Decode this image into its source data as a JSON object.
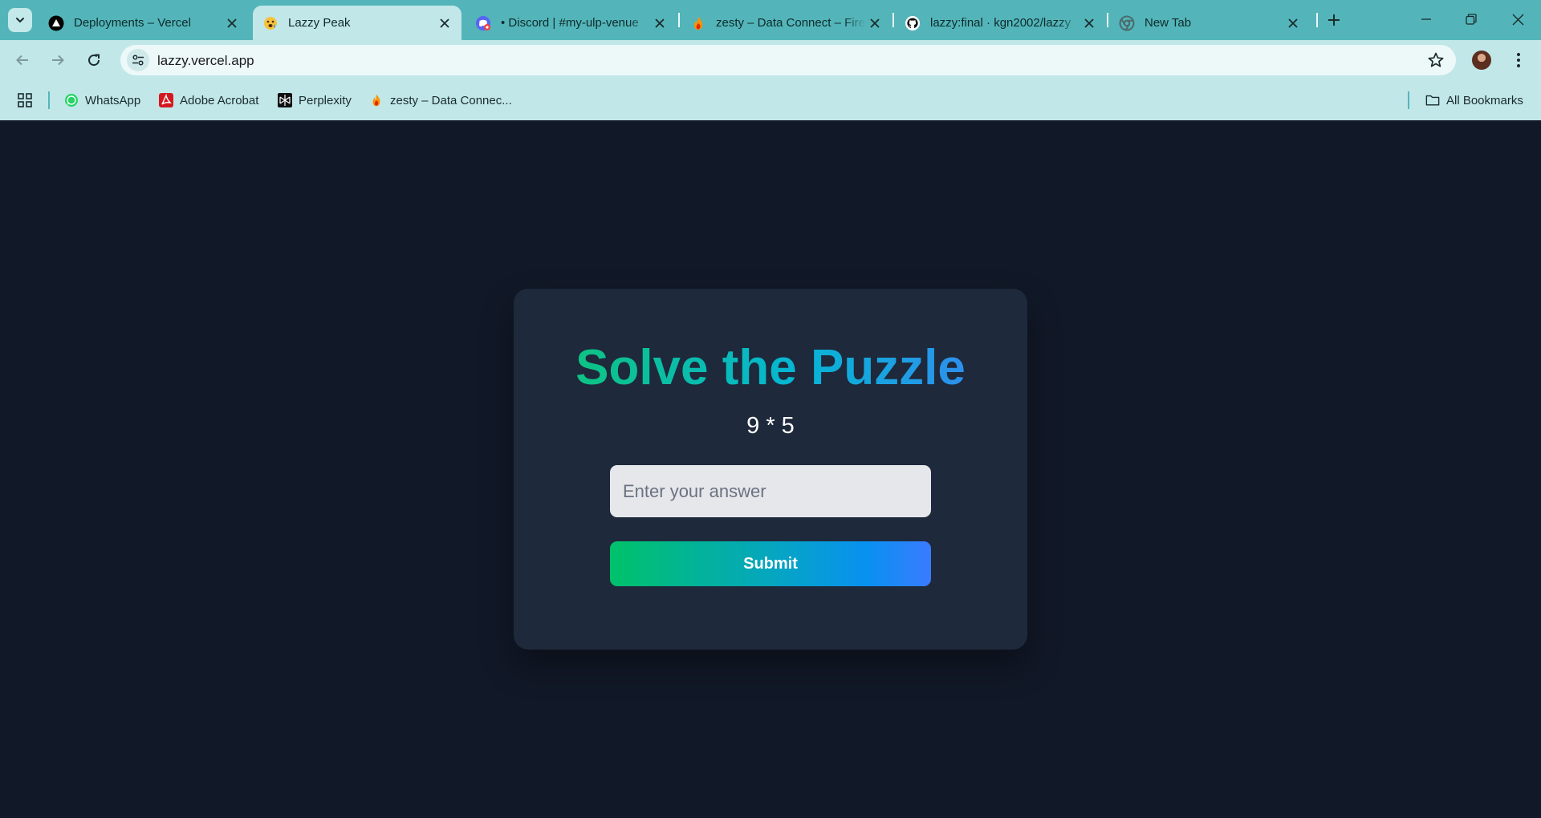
{
  "browser": {
    "tabs": [
      {
        "title": "Deployments – Vercel",
        "icon": "vercel-icon",
        "active": false
      },
      {
        "title": "Lazzy Peak",
        "icon": "emoji-face-icon",
        "active": true
      },
      {
        "title": "• Discord | #my-ulp-venue",
        "icon": "discord-icon",
        "active": false
      },
      {
        "title": "zesty – Data Connect – Fire",
        "icon": "firebase-icon",
        "active": false
      },
      {
        "title": "lazzy:final · kgn2002/lazzy",
        "icon": "github-icon",
        "active": false
      },
      {
        "title": "New Tab",
        "icon": "chrome-icon",
        "active": false
      }
    ],
    "address": "lazzy.vercel.app",
    "bookmarks": [
      {
        "label": "WhatsApp",
        "icon": "whatsapp-icon"
      },
      {
        "label": "Adobe Acrobat",
        "icon": "acrobat-icon"
      },
      {
        "label": "Perplexity",
        "icon": "perplexity-icon"
      },
      {
        "label": "zesty – Data Connec...",
        "icon": "firebase-icon"
      }
    ],
    "all_bookmarks": "All Bookmarks"
  },
  "page": {
    "title": "Solve the Puzzle",
    "puzzle": "9 * 5",
    "answer_placeholder": "Enter your answer",
    "answer_value": "",
    "submit_label": "Submit"
  },
  "colors": {
    "page_bg": "#111827",
    "card_bg": "#1e293b",
    "gradient_start": "#10c76b",
    "gradient_end": "#3b82f6",
    "chrome_frame": "#53b5b9",
    "chrome_toolbar": "#c1e7e9"
  }
}
